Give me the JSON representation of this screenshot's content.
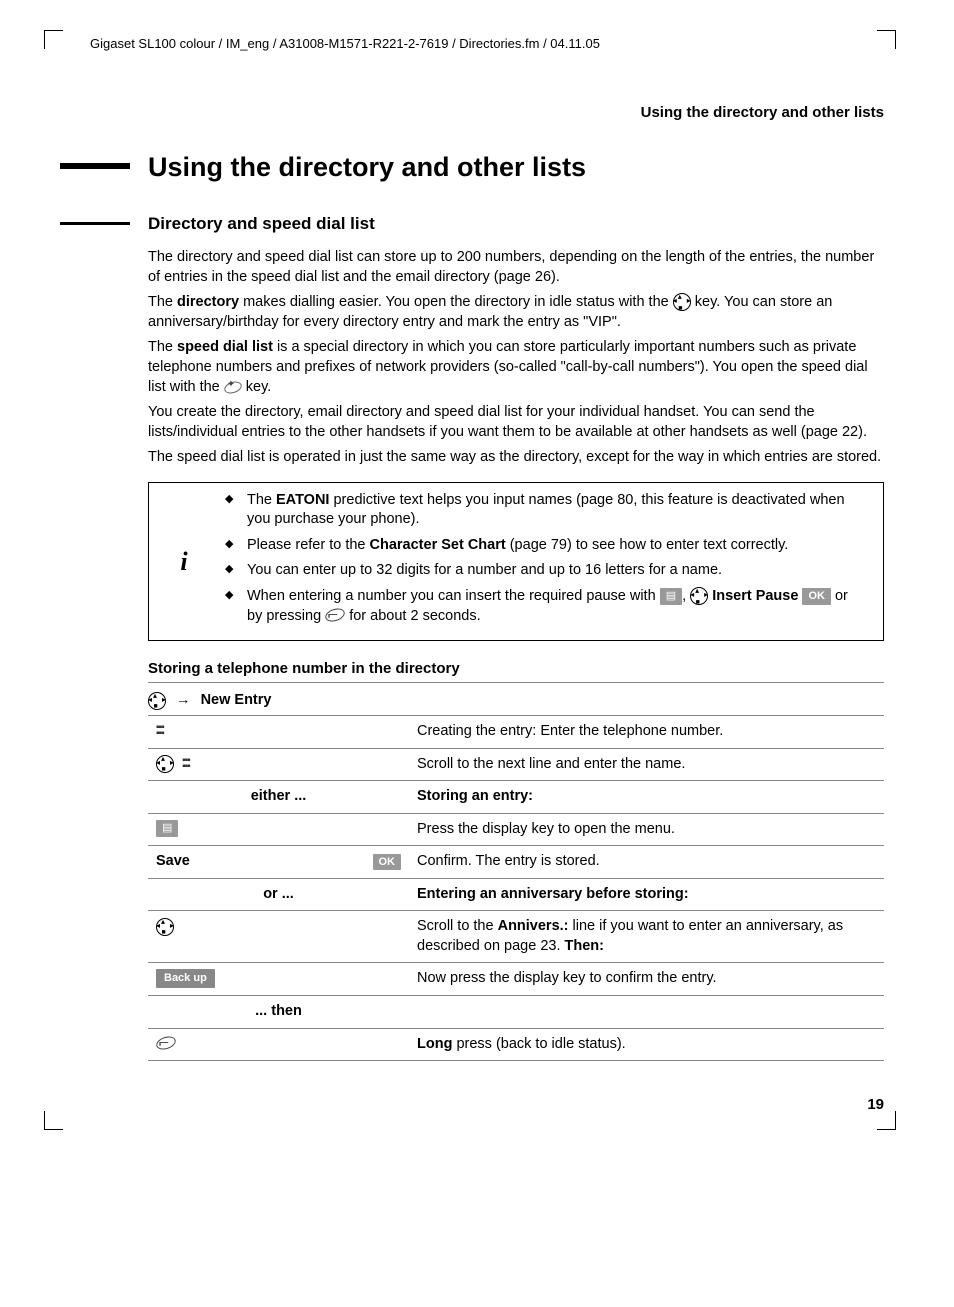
{
  "header_path": "Gigaset SL100 colour / IM_eng / A31008-M1571-R221-2-7619 / Directories.fm / 04.11.05",
  "running_head": "Using the directory and other lists",
  "h1": "Using the directory and other lists",
  "h2": "Directory and speed dial list",
  "para1": "The directory and speed dial list can store up to 200 numbers, depending on the length of the entries, the number of entries in the speed dial list and the email directory (page 26).",
  "para2a": "The ",
  "para2b": "directory",
  "para2c": " makes dialling easier. You open the directory in idle status with the ",
  "para2d": " key. You can store an anniversary/birthday for every directory entry and mark the entry as \"VIP\".",
  "para3a": "The ",
  "para3b": "speed dial list",
  "para3c": " is a special directory in which you can store particularly important numbers such as private telephone numbers and prefixes of network providers (so-called \"call-by-call numbers\"). You open the speed dial list with the ",
  "para3d": " key.",
  "para4": "You create the directory, email directory and speed dial list for your individual handset. You can send the lists/individual entries to the other handsets if you want them to be available at other handsets as well (page 22).",
  "para5": "The speed dial list is operated in just the same way as the directory, except for the way in which entries are stored.",
  "info": {
    "li1a": "The ",
    "li1b": "EATONI",
    "li1c": " predictive text helps you input names (page 80, this feature is deactivated when you purchase your phone).",
    "li2a": "Please refer to the ",
    "li2b": "Character Set Chart",
    "li2c": " (page 79) to see how to enter text correctly.",
    "li3": "You can enter up to 32 digits for a number and up to 16 letters for a name.",
    "li4a": "When entering a number you can insert the required pause with ",
    "li4b": ", ",
    "li4c": "Insert Pause",
    "li4d": " or by pressing ",
    "li4e": " for about 2 seconds."
  },
  "h3": "Storing a telephone number in the directory",
  "new_entry": "New Entry",
  "table": {
    "r1b": "Creating the entry: Enter the telephone number.",
    "r2b": "Scroll to the next line and enter the name.",
    "r3a": "either ...",
    "r3b": "Storing an entry:",
    "r4b": "Press the display key to open the menu.",
    "r5a": "Save",
    "r5ok": "OK",
    "r5b": "Confirm. The entry is stored.",
    "r6a": "or ...",
    "r6b": "Entering an anniversary before storing:",
    "r7b1": "Scroll to the ",
    "r7b2": "Annivers.:",
    "r7b3": " line if you want to enter an anniversary, as described on page 23. ",
    "r7b4": "Then:",
    "r8a": "Back up",
    "r8b": "Now press the display key to confirm the entry.",
    "r9a": "... then",
    "r10b1": "Long",
    "r10b2": " press (back to idle status)."
  },
  "page_num": "19",
  "ok_label": "OK"
}
